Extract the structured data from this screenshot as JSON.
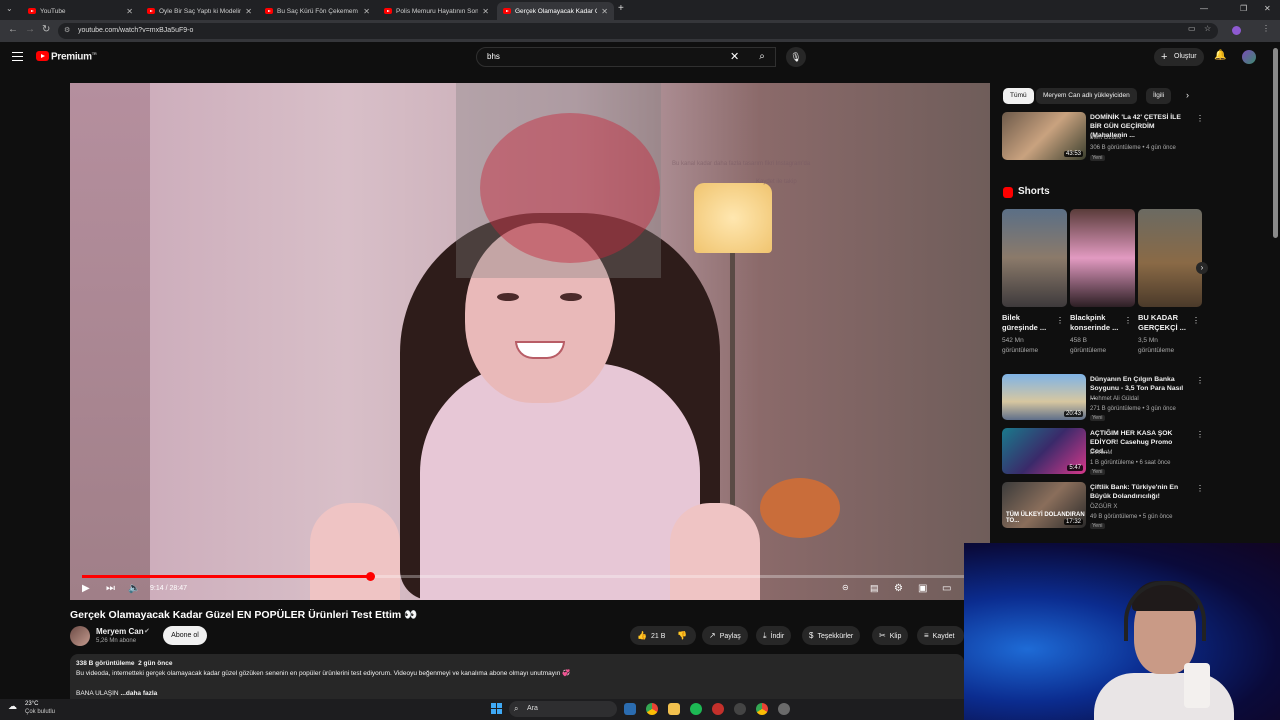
{
  "browser": {
    "tabs": [
      {
        "label": "YouTube",
        "active": false
      },
      {
        "label": "Öyle Bir Saç Yaptı ki Modelin Ai",
        "active": false
      },
      {
        "label": "Bu Saç Kürü Fön Çekemem Dedi",
        "active": false
      },
      {
        "label": "Polis Memuru Hayatının Son R",
        "active": false
      },
      {
        "label": "Gerçek Olamayacak Kadar Güze",
        "active": true
      }
    ],
    "new_tab": "+",
    "url": "youtube.com/watch?v=mxBJa5uF9-o"
  },
  "header": {
    "brand": "Premium",
    "brand_sup": "TR",
    "search_value": "bhs",
    "create_label": "Oluştur"
  },
  "player": {
    "time_current": "9:14",
    "time_total": "28:47",
    "progress_fraction": 0.321,
    "overlay_line1": "Bu kanal kadar daha fazla tasarım fikri Instagram'da",
    "overlay_line2": "Kaydet ile takip"
  },
  "video": {
    "title": "Gerçek Olamayacak Kadar Güzel EN POPÜLER Ürünleri Test Ettim 👀",
    "channel_name": "Meryem Can",
    "subscribers": "5,26 Mn abone",
    "subscribe_label": "Abone ol",
    "likes": "21 B",
    "share_label": "Paylaş",
    "download_label": "İndir",
    "thanks_label": "Teşekkürler",
    "clip_label": "Klip",
    "save_label": "Kaydet",
    "description": {
      "views": "338 B görüntüleme",
      "date": "2 gün önce",
      "text": "Bu videoda, internetteki gerçek olamayacak kadar güzel gözüken senenin en popüler ürünlerini test ediyorum. Videoyu beğenmeyi ve kanalıma abone olmayı unutmayın 💞",
      "line2": "BANA ULAŞIN",
      "more": "...daha fazla"
    }
  },
  "sidebar": {
    "chips": [
      {
        "label": "Tümü",
        "selected": true
      },
      {
        "label": "Meryem Can adlı yükleyiciden",
        "selected": false
      },
      {
        "label": "İlgili",
        "selected": false
      }
    ],
    "top_video": {
      "title": "DOMİNİK 'La 42' ÇETESİ İLE BİR GÜN GEÇİRDİM (Mahallenin ...",
      "channel": "Mert Öztürk",
      "meta": "306 B görüntüleme • 4 gün önce",
      "badge": "Yeni",
      "duration": "43:53"
    },
    "shorts_title": "Shorts",
    "shorts": [
      {
        "title": "Bilek güreşinde ...",
        "views": "542 Mn",
        "views_unit": "görüntüleme"
      },
      {
        "title": "Blackpink konserinde ...",
        "views": "458 B",
        "views_unit": "görüntüleme"
      },
      {
        "title": "BU KADAR GERÇEKÇİ ...",
        "views": "3,5 Mn",
        "views_unit": "görüntüleme"
      }
    ],
    "videos": [
      {
        "title": "Dünyanın En Çılgın Banka Soygunu - 3,5 Ton Para Nasıl ...",
        "channel": "Mehmet Ali Güldal",
        "meta": "271 B görüntüleme • 3 gün önce",
        "badge": "Yeni",
        "duration": "20:43"
      },
      {
        "title": "AÇTIĞIM HER KASA ŞOK EDİYOR! Casehug Promo Cod...",
        "channel": "DevonM",
        "meta": "1 B görüntüleme • 6 saat önce",
        "badge": "Yeni",
        "duration": "5:47"
      },
      {
        "title": "Çiftlik Bank: Türkiye'nin En Büyük Dolandırıcılığı!",
        "channel": "ÖZGÜR X",
        "meta": "49 B görüntüleme • 5 gün önce",
        "badge": "Yeni",
        "duration": "17:32"
      }
    ],
    "thumb_overlay_text": "TÜM ÜLKEYİ DOLANDIRAN TO..."
  },
  "taskbar": {
    "temp": "23°C",
    "weather": "Çok bulutlu",
    "search_label": "Ara"
  },
  "colors": {
    "accent": "#ff0000",
    "background": "#0f0f0f",
    "pill": "#272727"
  }
}
